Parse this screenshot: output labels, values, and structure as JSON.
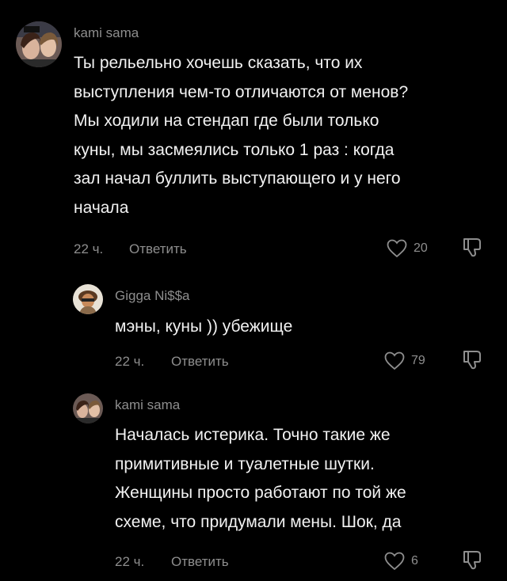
{
  "comments": [
    {
      "username": "kami sama",
      "text": "Ты рельельно хочешь сказать, что их\nвыступления чем-то отличаются от менов?\nМы ходили на стендап где были только\nкуны, мы засмеялись только 1 раз : когда\nзал начал буллить выступающего и у него\nначала",
      "time": "22 ч.",
      "reply_label": "Ответить",
      "likes": "20"
    },
    {
      "username": "Gigga Ni$$a",
      "text": "мэны, куны )) убежище",
      "time": "22 ч.",
      "reply_label": "Ответить",
      "likes": "79"
    },
    {
      "username": "kami sama",
      "text": "Началась истерика. Точно такие же\nпримитивные и туалетные шутки.\nЖенщины просто работают по той же\nсхеме, что придумали мены. Шок, да",
      "time": "22 ч.",
      "reply_label": "Ответить",
      "likes": "6"
    }
  ],
  "icons": {
    "like": "heart-outline-icon",
    "dislike": "thumbs-down-outline-icon"
  },
  "colors": {
    "background": "#000000",
    "secondary_text": "#8e8e8e",
    "primary_text": "#f2f2f2"
  }
}
